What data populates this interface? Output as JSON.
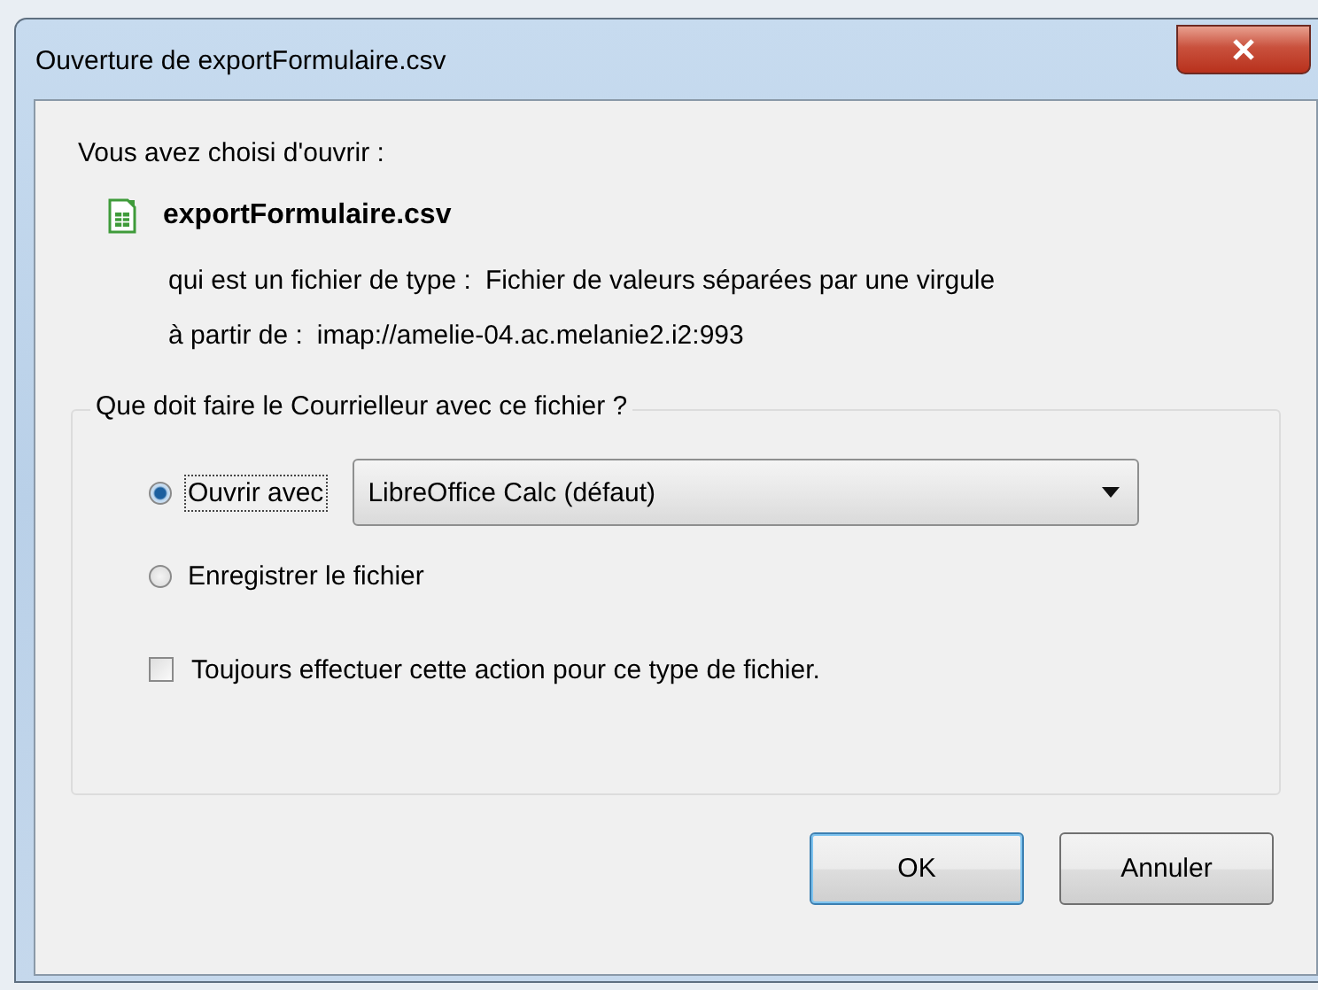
{
  "window": {
    "title": "Ouverture de exportFormulaire.csv"
  },
  "intro": "Vous avez choisi d'ouvrir :",
  "file": {
    "name": "exportFormulaire.csv",
    "type_label": "qui est un fichier de type :",
    "type_value": "Fichier de valeurs séparées par une virgule",
    "from_label": "à partir de :",
    "from_value": "imap://amelie-04.ac.melanie2.i2:993"
  },
  "group": {
    "legend": "Que doit faire le Courrielleur avec ce fichier ?",
    "options": [
      {
        "kind": "radio",
        "label": "Ouvrir avec",
        "selected": true,
        "dropdown": "LibreOffice Calc (défaut)"
      },
      {
        "kind": "radio",
        "label": "Enregistrer le fichier",
        "selected": false
      }
    ],
    "always": {
      "label": "Toujours effectuer cette action pour ce type de fichier.",
      "checked": false
    }
  },
  "buttons": [
    {
      "label": "OK",
      "default": true
    },
    {
      "label": "Annuler",
      "default": false
    }
  ]
}
